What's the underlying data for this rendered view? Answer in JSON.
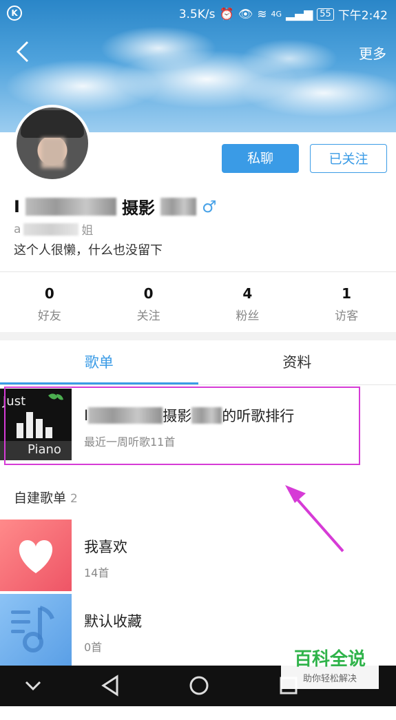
{
  "status_bar": {
    "network_speed": "3.5K/s",
    "network_type": "4G",
    "battery": "55",
    "time": "下午2:42"
  },
  "header": {
    "back_icon": "chevron-left-icon",
    "more_label": "更多"
  },
  "profile": {
    "name_visible": "摄影",
    "name_prefix": "I",
    "subtitle_prefix": "a",
    "subtitle_suffix": "姐",
    "bio": "这个人很懒，什么也没留下",
    "gender_icon": "♂",
    "chat_button": "私聊",
    "follow_button": "已关注"
  },
  "stats": [
    {
      "value": "0",
      "label": "好友"
    },
    {
      "value": "0",
      "label": "关注"
    },
    {
      "value": "4",
      "label": "粉丝"
    },
    {
      "value": "1",
      "label": "访客"
    }
  ],
  "tabs": [
    {
      "label": "歌单"
    },
    {
      "label": "资料"
    }
  ],
  "ranking": {
    "title_prefix": "I",
    "title_mid": "摄影",
    "title_suffix": "的听歌排行",
    "meta": "最近一周听歌11首",
    "thumb_text_1": "Just",
    "thumb_text_2": "Piano"
  },
  "section": {
    "label": "自建歌单",
    "count": "2"
  },
  "playlists": [
    {
      "title": "我喜欢",
      "meta": "14首",
      "icon": "heart-icon",
      "color": "#f0626a"
    },
    {
      "title": "默认收藏",
      "meta": "0首",
      "icon": "music-note-icon",
      "color": "#6aaef0"
    }
  ],
  "watermark": {
    "title": "百科全说",
    "subtitle": "助你轻松解决"
  },
  "colors": {
    "accent": "#3a9be6",
    "highlight": "#d63bd6"
  }
}
